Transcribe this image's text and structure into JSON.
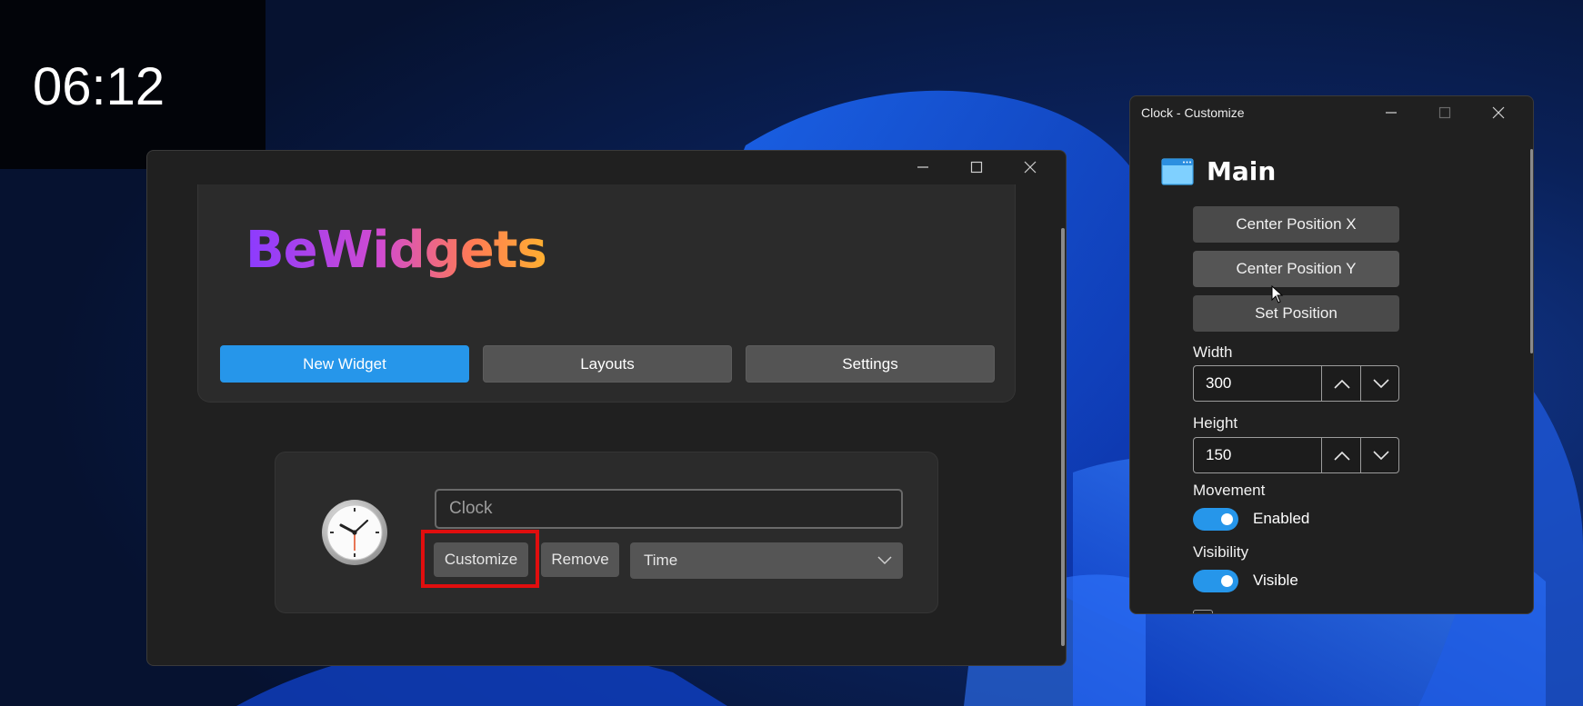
{
  "desktop_clock": {
    "time": "06:12"
  },
  "app": {
    "brand": "BeWidgets",
    "nav": {
      "new_widget": "New Widget",
      "layouts": "Layouts",
      "settings": "Settings"
    },
    "widget": {
      "name_value": "Clock",
      "customize_label": "Customize",
      "remove_label": "Remove",
      "type_value": "Time"
    }
  },
  "customize_window": {
    "title": "Clock - Customize",
    "section_title": "Main",
    "center_x_label": "Center Position X",
    "center_y_label": "Center Position Y",
    "set_position_label": "Set Position",
    "width_label": "Width",
    "width_value": "300",
    "height_label": "Height",
    "height_value": "150",
    "movement_label": "Movement",
    "movement_state": "Enabled",
    "visibility_label": "Visibility",
    "visibility_state": "Visible"
  },
  "colors": {
    "accent": "#2696EA",
    "highlight": "#E10E0E"
  }
}
